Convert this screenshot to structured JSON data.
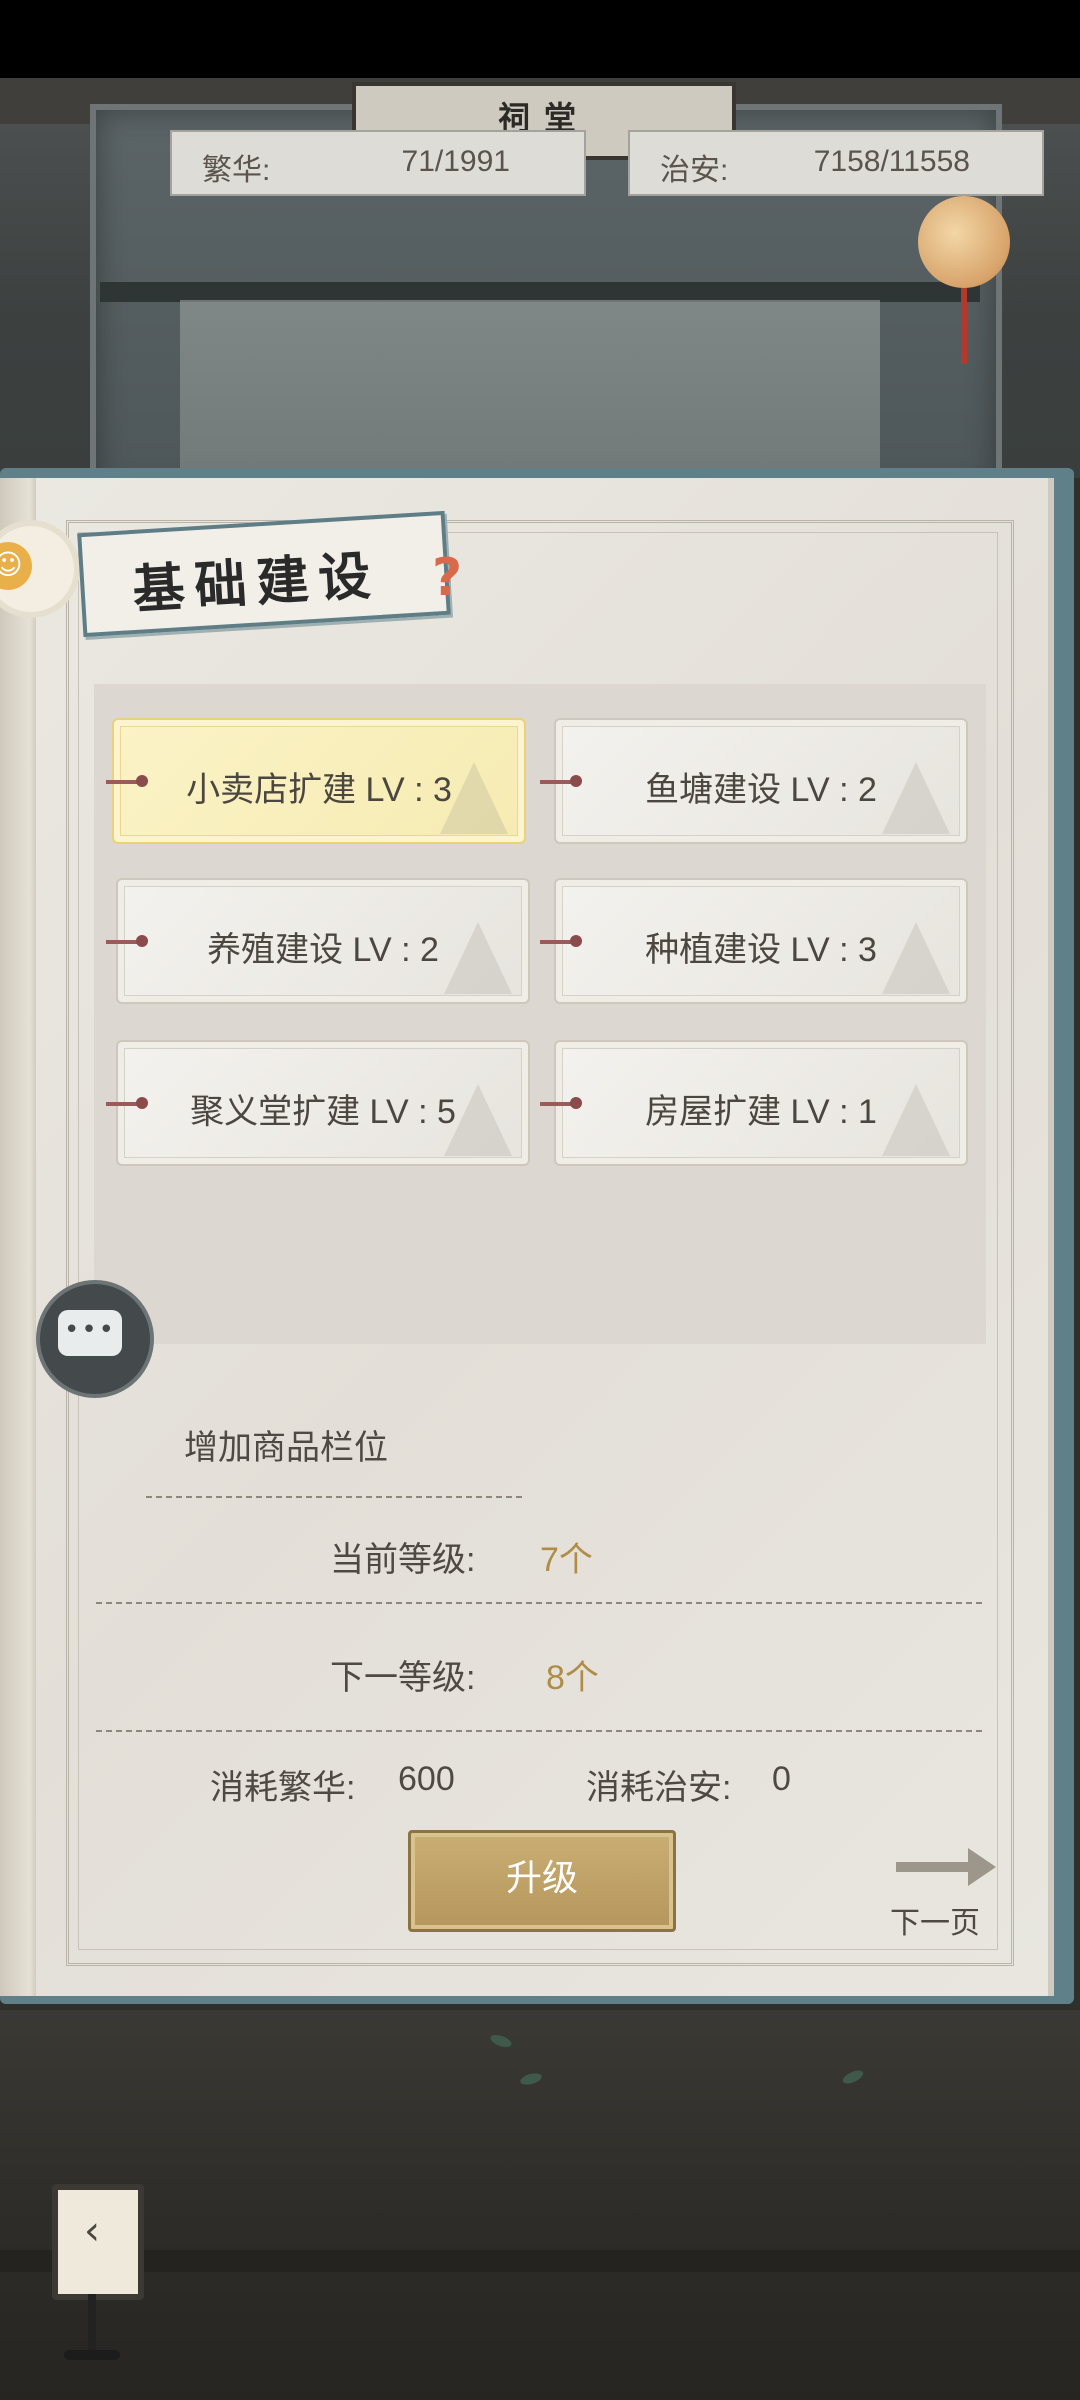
{
  "header": {
    "plaque": "祠堂",
    "prosperity": {
      "label": "繁华:",
      "value": "71/1991"
    },
    "security": {
      "label": "治安:",
      "value": "7158/11558"
    }
  },
  "panel": {
    "title": "基础建设",
    "buildings": [
      {
        "label": "小卖店扩建 LV : 3",
        "selected": true
      },
      {
        "label": "鱼塘建设 LV : 2",
        "selected": false
      },
      {
        "label": "养殖建设 LV : 2",
        "selected": false
      },
      {
        "label": "种植建设 LV : 3",
        "selected": false
      },
      {
        "label": "聚义堂扩建 LV : 5",
        "selected": false
      },
      {
        "label": "房屋扩建 LV : 1",
        "selected": false
      }
    ],
    "detail": {
      "effect": "增加商品栏位",
      "current_label": "当前等级:",
      "current_value": "7个",
      "next_label": "下一等级:",
      "next_value": "8个",
      "cost_prosperity_label": "消耗繁华:",
      "cost_prosperity_value": "600",
      "cost_security_label": "消耗治安:",
      "cost_security_value": "0"
    },
    "upgrade_label": "升级",
    "next_page_label": "下一页"
  },
  "icons": {
    "chat": "chat-bubble-icon",
    "badge": "smile-badge-icon",
    "lamp": "back-lantern-icon"
  },
  "colors": {
    "accent_gold": "#b08d47",
    "selected_card": "#f6ebb2",
    "frame_blue": "#5f8089"
  }
}
